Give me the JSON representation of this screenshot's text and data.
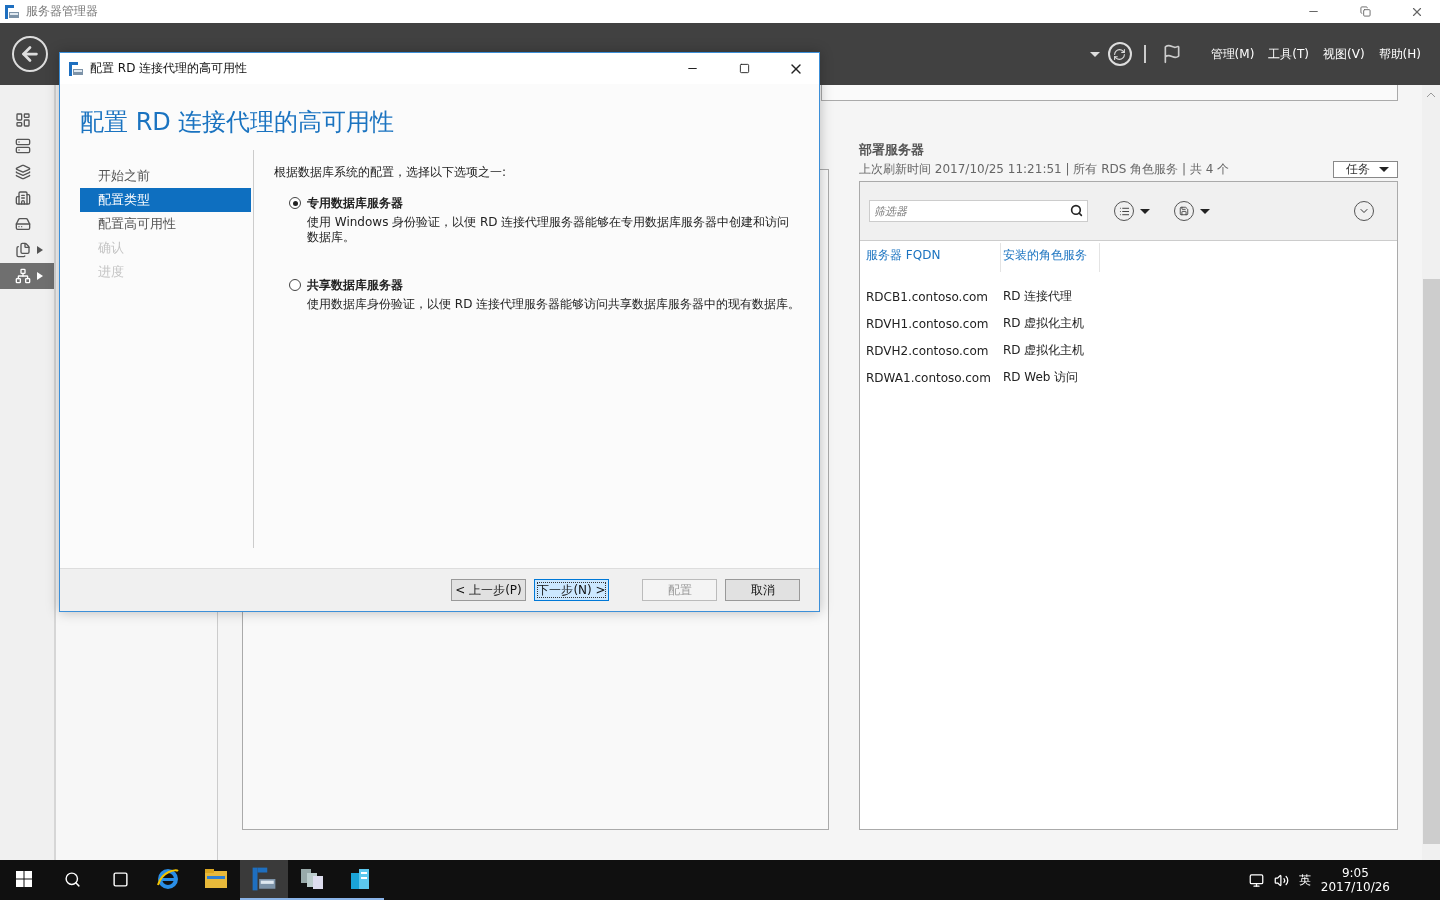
{
  "app_window": {
    "title": "服务器管理器"
  },
  "header": {
    "menus": [
      "管理(M)",
      "工具(T)",
      "视图(V)",
      "帮助(H)"
    ]
  },
  "nav": [
    {
      "selected": false,
      "expandable": false
    },
    {
      "selected": false,
      "expandable": false
    },
    {
      "selected": false,
      "expandable": false
    },
    {
      "selected": false,
      "expandable": false
    },
    {
      "selected": false,
      "expandable": false
    },
    {
      "selected": false,
      "expandable": true
    },
    {
      "selected": true,
      "expandable": true
    }
  ],
  "deployment_servers": {
    "title": "部署服务器",
    "subtitle": "上次刷新时间 2017/10/25 11:21:51 | 所有 RDS 角色服务  | 共 4 个",
    "tasks_button": "任务",
    "filter": {
      "placeholder": "筛选器"
    },
    "columns": [
      "服务器 FQDN",
      "安装的角色服务"
    ],
    "rows": [
      [
        "RDCB1.contoso.com",
        "RD 连接代理"
      ],
      [
        "RDVH1.contoso.com",
        "RD 虚拟化主机"
      ],
      [
        "RDVH2.contoso.com",
        "RD 虚拟化主机"
      ],
      [
        "RDWA1.contoso.com",
        "RD Web 访问"
      ]
    ]
  },
  "dialog": {
    "title": "配置 RD 连接代理的高可用性",
    "heading": "配置 RD 连接代理的高可用性",
    "steps": [
      {
        "label": "开始之前",
        "selected": false,
        "disabled": false
      },
      {
        "label": "配置类型",
        "selected": true,
        "disabled": false
      },
      {
        "label": "配置高可用性",
        "selected": false,
        "disabled": false
      },
      {
        "label": "确认",
        "selected": false,
        "disabled": true
      },
      {
        "label": "进度",
        "selected": false,
        "disabled": true
      }
    ],
    "prompt": "根据数据库系统的配置，选择以下选项之一:",
    "options": [
      {
        "label": "专用数据库服务器",
        "description": "使用 Windows 身份验证，以便 RD 连接代理服务器能够在专用数据库服务器中创建和访问数据库。",
        "selected": true
      },
      {
        "label": "共享数据库服务器",
        "description": "使用数据库身份验证，以便 RD 连接代理服务器能够访问共享数据库服务器中的现有数据库。",
        "selected": false
      }
    ],
    "buttons": [
      {
        "label": "< 上一步(P)",
        "focused": false,
        "disabled": false
      },
      {
        "label": "下一步(N) >",
        "focused": true,
        "disabled": false
      },
      {
        "label": "配置",
        "focused": false,
        "disabled": true
      },
      {
        "label": "取消",
        "focused": false,
        "disabled": false
      }
    ]
  },
  "taskbar": {
    "apps": [
      {
        "selected": false,
        "running": false
      },
      {
        "selected": false,
        "running": false
      },
      {
        "selected": true,
        "running": true
      },
      {
        "selected": false,
        "running": true
      },
      {
        "selected": false,
        "running": true
      }
    ],
    "ime": "英",
    "time": "9:05",
    "date": "2017/10/26"
  }
}
